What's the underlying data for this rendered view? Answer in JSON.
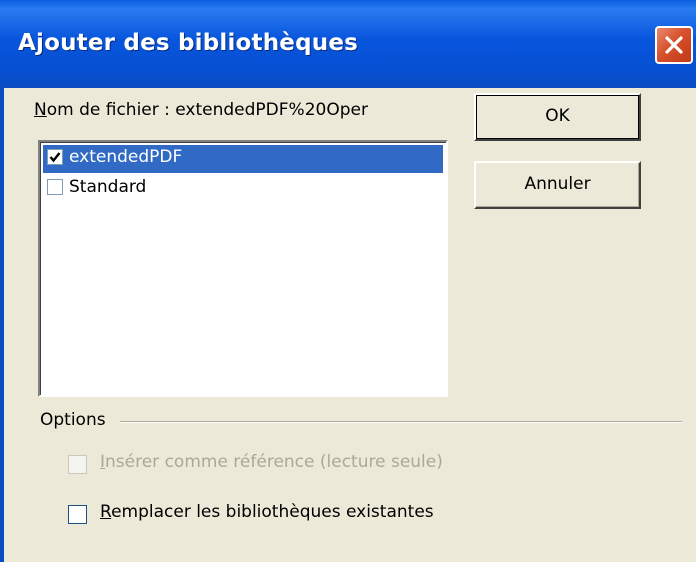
{
  "window": {
    "title": "Ajouter des bibliothèques"
  },
  "file": {
    "label_mnemonic": "N",
    "label_rest": "om de fichier : extendedPDF%20Oper"
  },
  "libraries": [
    {
      "name": "extendedPDF",
      "checked": true,
      "selected": true
    },
    {
      "name": "Standard",
      "checked": false,
      "selected": false
    }
  ],
  "buttons": {
    "ok_label": "OK",
    "cancel_label": "Annuler"
  },
  "options": {
    "group_label": "Options",
    "insert_ref_mnemonic": "I",
    "insert_ref_rest": "nsérer comme référence (lecture seule)",
    "insert_ref_checked": false,
    "insert_ref_enabled": false,
    "replace_mnemonic": "R",
    "replace_rest": "emplacer les bibliothèques existantes",
    "replace_checked": false,
    "replace_enabled": true
  },
  "colors": {
    "titlebar": "#0855dd",
    "selection": "#316ac5",
    "face": "#ece9d8",
    "close": "#d6512c"
  },
  "icons": {
    "close": "close-icon",
    "check": "checkmark-icon"
  }
}
